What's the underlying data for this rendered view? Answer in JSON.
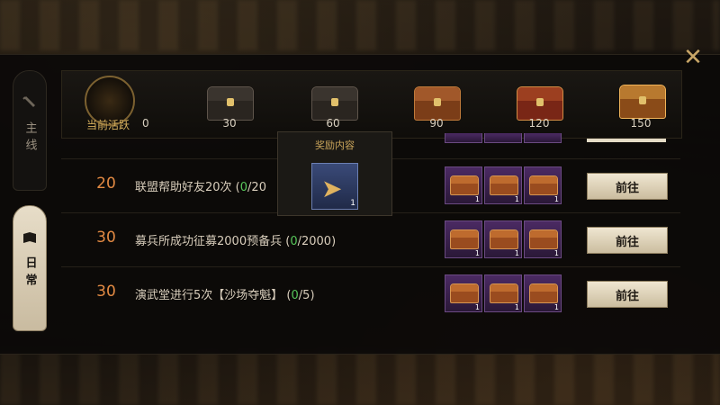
{
  "sidebar": {
    "tabs": [
      {
        "label": "主线",
        "icon": "scroll-icon"
      },
      {
        "label": "日常",
        "icon": "book-icon"
      }
    ]
  },
  "activity": {
    "label": "当前活跃",
    "value": "0",
    "milestones": [
      "30",
      "60",
      "90",
      "120",
      "150"
    ]
  },
  "tooltip": {
    "title": "奖励内容",
    "item_count": "1",
    "icon": "speedup-arrows-icon"
  },
  "tasks": [
    {
      "points": "20",
      "text": "联盟帮助好友20次",
      "progress_open": " (",
      "progress_current": "0",
      "progress_rest": "/20",
      "progress_close": "",
      "reward_count": "1",
      "button": "前往"
    },
    {
      "points": "30",
      "text": "募兵所成功征募2000预备兵",
      "progress_open": " (",
      "progress_current": "0",
      "progress_rest": "/2000",
      "progress_close": ")",
      "reward_count": "1",
      "button": "前往"
    },
    {
      "points": "30",
      "text": "演武堂进行5次【沙场夺魁】",
      "progress_open": " (",
      "progress_current": "0",
      "progress_rest": "/5",
      "progress_close": ")",
      "reward_count": "1",
      "button": "前往"
    }
  ],
  "colors": {
    "accent_gold": "#c9a45a",
    "points": "#e38a43",
    "progress_current": "#57c65a"
  }
}
